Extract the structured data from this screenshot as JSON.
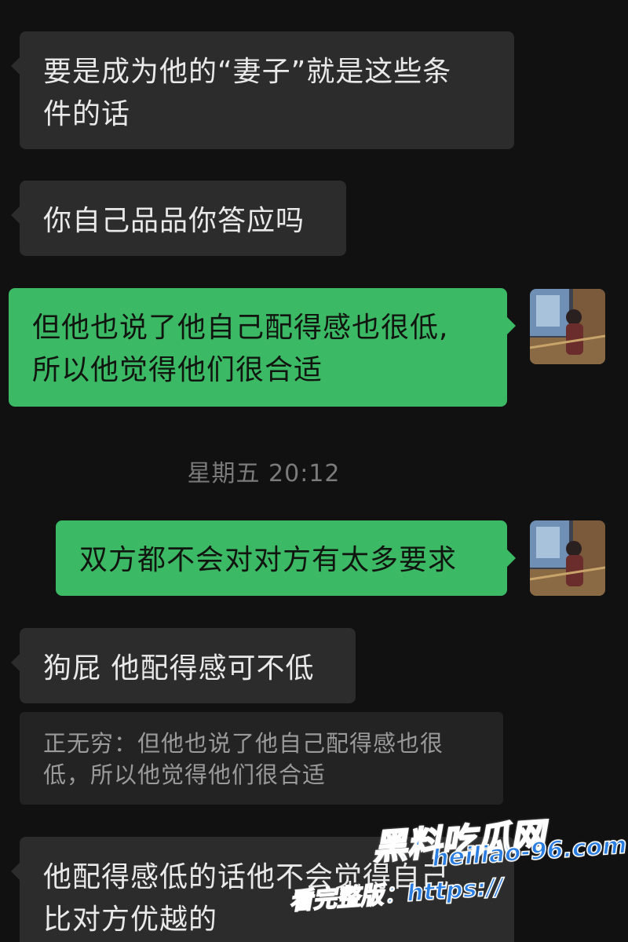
{
  "messages": [
    {
      "side": "left",
      "lines": [
        "要是成为他的“妻子”就是这些条",
        "件的话"
      ]
    },
    {
      "side": "left",
      "lines": [
        "你自己品品你答应吗"
      ]
    },
    {
      "side": "right",
      "lines": [
        "但他也说了他自己配得感也很低,",
        "所以他觉得他们很合适"
      ]
    },
    {
      "side": "right",
      "lines": [
        "双方都不会对对方有太多要求"
      ]
    },
    {
      "side": "left",
      "lines": [
        "狗屁 他配得感可不低"
      ]
    },
    {
      "side": "left",
      "lines": [
        "他配得感低的话他不会觉得自己",
        "比对方优越的"
      ]
    }
  ],
  "timestamp": "星期五 20:12",
  "quote": {
    "line1": "正无穷：但他也说了他自己配得感也很",
    "line2": "低，所以他觉得他们很合适"
  },
  "watermark": {
    "brand": "黑料吃瓜网",
    "domain": "heiliao-96.com",
    "caption": "看完整版：https://"
  },
  "colors": {
    "background": "#111111",
    "left_bubble": "#2c2c2c",
    "right_bubble": "#3cb964",
    "quote_bg": "#232323",
    "watermark_blue": "#2a7de1"
  },
  "icons": {
    "avatar": "user-photo-avatar"
  }
}
